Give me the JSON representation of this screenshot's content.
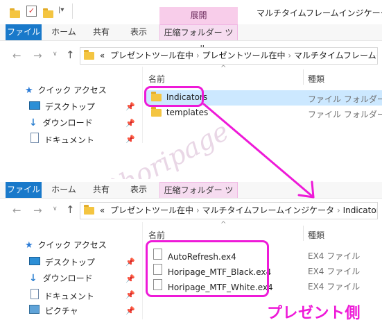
{
  "top_window": {
    "title": "マルチタイムフレームインジケータ",
    "context_group_label": "展開",
    "tabs": [
      "ファイル",
      "ホーム",
      "共有",
      "表示",
      "圧縮フォルダー ツール"
    ],
    "address": {
      "prefix": "«",
      "segments": [
        "プレゼントツール在中",
        "プレゼントツール在中",
        "マルチタイムフレームインジケータ"
      ]
    },
    "nav_pane": [
      {
        "label": "クイック アクセス",
        "icon": "star-icon"
      },
      {
        "label": "デスクトップ",
        "icon": "desktop-icon"
      },
      {
        "label": "ダウンロード",
        "icon": "download-icon"
      },
      {
        "label": "ドキュメント",
        "icon": "document-icon"
      }
    ],
    "columns": {
      "name": "名前",
      "type": "種類"
    },
    "rows": [
      {
        "name": "Indicators",
        "type": "ファイル フォルダー",
        "selected": true
      },
      {
        "name": "templates",
        "type": "ファイル フォルダー",
        "selected": false
      }
    ]
  },
  "bottom_window": {
    "tabs": [
      "ファイル",
      "ホーム",
      "共有",
      "表示",
      "圧縮フォルダー ツール"
    ],
    "address": {
      "prefix": "«",
      "segments": [
        "プレゼントツール在中",
        "マルチタイムフレームインジケータ",
        "Indicators"
      ]
    },
    "nav_pane": [
      {
        "label": "クイック アクセス",
        "icon": "star-icon"
      },
      {
        "label": "デスクトップ",
        "icon": "desktop-icon"
      },
      {
        "label": "ダウンロード",
        "icon": "download-icon"
      },
      {
        "label": "ドキュメント",
        "icon": "document-icon"
      },
      {
        "label": "ピクチャ",
        "icon": "picture-icon"
      }
    ],
    "columns": {
      "name": "名前",
      "type": "種類"
    },
    "rows": [
      {
        "name": "AutoRefresh.ex4",
        "type": "EX4 ファイル"
      },
      {
        "name": "Horipage_MTF_Black.ex4",
        "type": "EX4 ファイル"
      },
      {
        "name": "Horipage_MTF_White.ex4",
        "type": "EX4 ファイル"
      }
    ]
  },
  "annotation": {
    "caption": "プレゼント側",
    "watermark": "(C)horipage",
    "highlight_color": "#ee1ad8"
  }
}
